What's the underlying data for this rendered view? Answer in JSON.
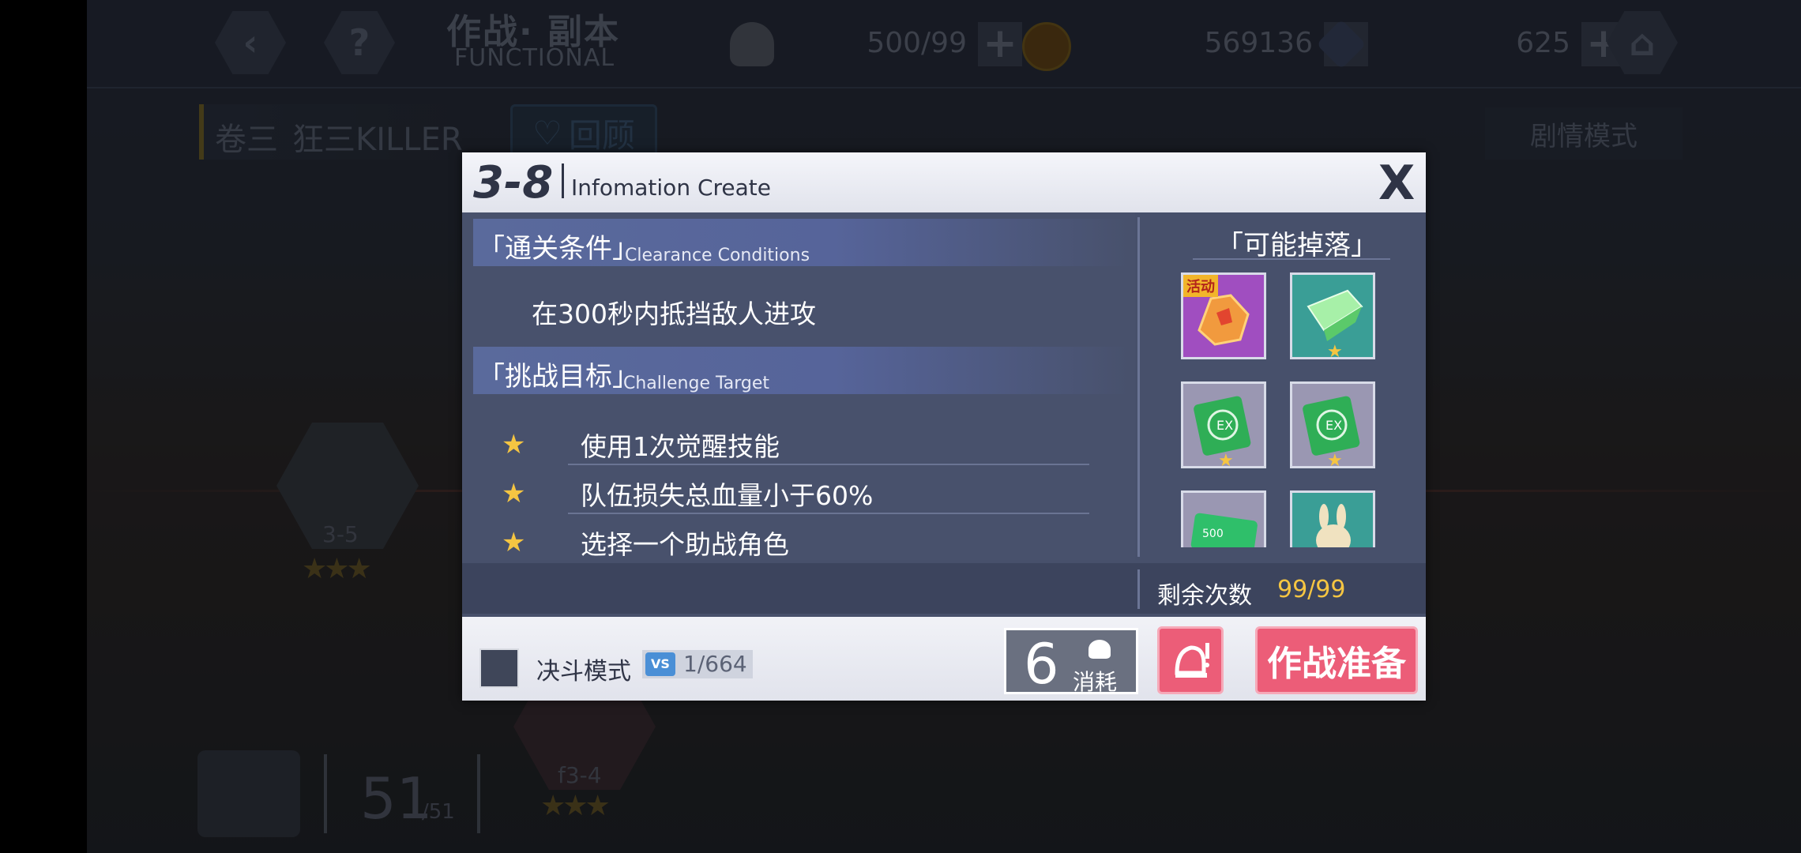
{
  "top_bar": {
    "title_cn": "作战· 副本",
    "title_en": "FUNCTIONAL",
    "resources": [
      {
        "name": "stamina",
        "value": "500/99"
      },
      {
        "name": "gold",
        "value": "569136"
      },
      {
        "name": "crystal",
        "value": "625"
      }
    ],
    "plus_label": "+",
    "back_label": "‹",
    "help_label": "?"
  },
  "chapter": {
    "volume": "卷三",
    "name": "狂三KILLER",
    "review_label": "回顾",
    "mode_label": "剧情模式"
  },
  "map": {
    "nodes": [
      {
        "label": "3-5",
        "stars": "★★★"
      },
      {
        "label": "f3-4",
        "stars": "★★★"
      }
    ],
    "star_total": "51",
    "star_max": "/51"
  },
  "modal": {
    "stage_id": "3-8",
    "stage_name": "Infomation Create",
    "close_label": "X",
    "clearance": {
      "title_cn": "「通关条件」",
      "title_en": "Clearance Conditions",
      "text": "在300秒内抵挡敌人进攻"
    },
    "challenge": {
      "title_cn": "「挑战目标」",
      "title_en": "Challenge Target",
      "goals": [
        "使用1次觉醒技能",
        "队伍损失总血量小于60%",
        "选择一个助战角色"
      ]
    },
    "drops": {
      "title": "「可能掉落」",
      "event_tag": "活动",
      "items": [
        {
          "icon": "orange-crystal-icon",
          "color": "#a04ec0"
        },
        {
          "icon": "green-gem-icon",
          "color": "#3a9e96"
        },
        {
          "icon": "exp-book-icon",
          "color": "#9a97b2"
        },
        {
          "icon": "exp-book-icon",
          "color": "#9a97b2"
        },
        {
          "icon": "gold-card-icon",
          "color": "#9a97b2"
        },
        {
          "icon": "rabbit-icon",
          "color": "#3a9e96"
        }
      ]
    },
    "remaining": {
      "label": "剩余次数",
      "value": "99/99"
    },
    "footer": {
      "duel_label": "决斗模式",
      "vs_icon": "VS",
      "vs_count": "1/664",
      "cost_value": "6",
      "cost_label": "消耗",
      "prepare_label": "作战准备"
    }
  }
}
